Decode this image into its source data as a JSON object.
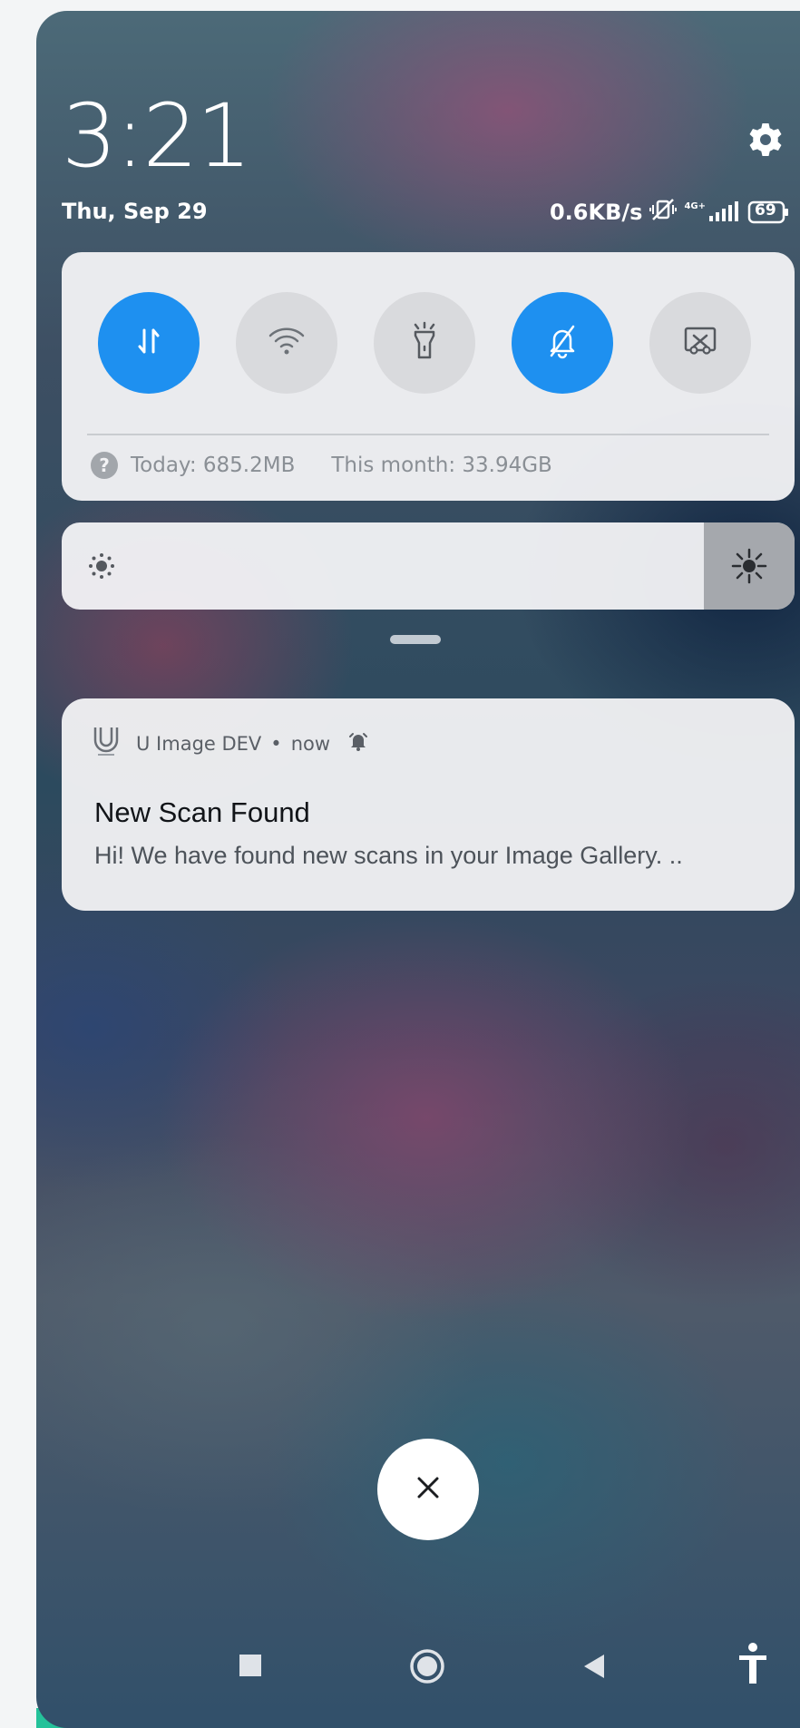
{
  "status_bar": {
    "time": "3:21",
    "date": "Thu, Sep 29",
    "net_speed": "0.6KB/s",
    "network_type": "4G+",
    "battery": "69"
  },
  "quick_settings": {
    "toggles": [
      {
        "name": "mobile-data-icon",
        "active": true
      },
      {
        "name": "wifi-icon",
        "active": false
      },
      {
        "name": "flashlight-icon",
        "active": false
      },
      {
        "name": "silent-bell-icon",
        "active": true
      },
      {
        "name": "screenshot-icon",
        "active": false
      }
    ],
    "usage_today": "Today: 685.2MB",
    "usage_month": "This month: 33.94GB",
    "help_icon": "?"
  },
  "brightness": {
    "level": 0.88
  },
  "notification": {
    "app_name": "U Image DEV",
    "separator": "•",
    "time": "now",
    "title": "New Scan Found",
    "body": "Hi! We have found new scans in your Image Gallery. .."
  },
  "colors": {
    "accent": "#1e90f0",
    "green_edge": "#24c29a"
  },
  "controls": {
    "close_label": "×"
  }
}
